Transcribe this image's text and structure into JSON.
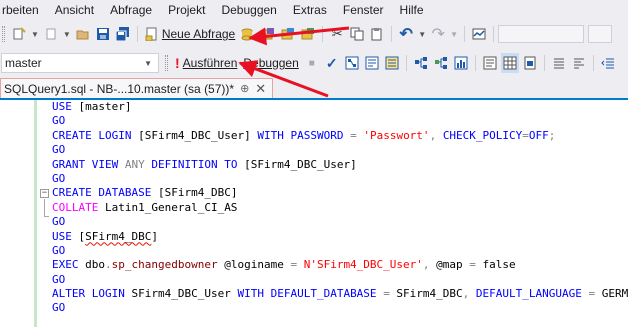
{
  "menu": {
    "items": [
      "rbeiten",
      "Ansicht",
      "Abfrage",
      "Projekt",
      "Debuggen",
      "Extras",
      "Fenster",
      "Hilfe"
    ]
  },
  "toolbar1": {
    "new_query_label": "Neue Abfrage"
  },
  "toolbar2": {
    "database_value": "master",
    "execute_label": "Ausführen",
    "debug_label": "Debuggen"
  },
  "tab": {
    "title": "SQLQuery1.sql - NB-...10.master (sa (57))*",
    "pin_glyph": "⊕",
    "close_glyph": "✕"
  },
  "code_lines": [
    [
      {
        "c": "kw",
        "t": "USE"
      },
      {
        "c": "tx",
        "t": " [master]"
      }
    ],
    [
      {
        "c": "kw",
        "t": "GO"
      }
    ],
    [
      {
        "c": "kw",
        "t": "CREATE"
      },
      {
        "c": "tx",
        "t": " "
      },
      {
        "c": "kw",
        "t": "LOGIN"
      },
      {
        "c": "tx",
        "t": " [SFirm4_DBC_User] "
      },
      {
        "c": "kw",
        "t": "WITH"
      },
      {
        "c": "tx",
        "t": " "
      },
      {
        "c": "kw",
        "t": "PASSWORD"
      },
      {
        "c": "tx",
        "t": " "
      },
      {
        "c": "gr",
        "t": "="
      },
      {
        "c": "tx",
        "t": " "
      },
      {
        "c": "st",
        "t": "'Passwort'"
      },
      {
        "c": "gr",
        "t": ","
      },
      {
        "c": "tx",
        "t": " "
      },
      {
        "c": "kw",
        "t": "CHECK_POLICY"
      },
      {
        "c": "gr",
        "t": "="
      },
      {
        "c": "kw",
        "t": "OFF"
      },
      {
        "c": "gr",
        "t": ";"
      }
    ],
    [
      {
        "c": "kw",
        "t": "GO"
      }
    ],
    [
      {
        "c": "kw",
        "t": "GRANT"
      },
      {
        "c": "tx",
        "t": " "
      },
      {
        "c": "kw",
        "t": "VIEW"
      },
      {
        "c": "tx",
        "t": " "
      },
      {
        "c": "gr",
        "t": "ANY"
      },
      {
        "c": "tx",
        "t": " "
      },
      {
        "c": "kw",
        "t": "DEFINITION"
      },
      {
        "c": "tx",
        "t": " "
      },
      {
        "c": "kw",
        "t": "TO"
      },
      {
        "c": "tx",
        "t": " [SFirm4_DBC_User]"
      }
    ],
    [
      {
        "c": "kw",
        "t": "GO"
      }
    ],
    [
      {
        "c": "kw",
        "t": "CREATE"
      },
      {
        "c": "tx",
        "t": " "
      },
      {
        "c": "kw",
        "t": "DATABASE"
      },
      {
        "c": "tx",
        "t": " [SFirm4_DBC]"
      }
    ],
    [
      {
        "c": "kwf",
        "t": "COLLATE"
      },
      {
        "c": "tx",
        "t": " Latin1_General_CI_AS"
      }
    ],
    [
      {
        "c": "kw",
        "t": "GO"
      }
    ],
    [
      {
        "c": "kw",
        "t": "USE"
      },
      {
        "c": "tx",
        "t": " ["
      },
      {
        "c": "tx squig",
        "t": "SFirm4_DBC"
      },
      {
        "c": "tx",
        "t": "]"
      }
    ],
    [
      {
        "c": "kw",
        "t": "GO"
      }
    ],
    [
      {
        "c": "kw",
        "t": "EXEC"
      },
      {
        "c": "tx",
        "t": " dbo"
      },
      {
        "c": "gr",
        "t": "."
      },
      {
        "c": "fn",
        "t": "sp_changedbowner"
      },
      {
        "c": "tx",
        "t": " @loginame "
      },
      {
        "c": "gr",
        "t": "="
      },
      {
        "c": "tx",
        "t": " "
      },
      {
        "c": "st",
        "t": "N'SFirm4_DBC_User'"
      },
      {
        "c": "gr",
        "t": ","
      },
      {
        "c": "tx",
        "t": " @map "
      },
      {
        "c": "gr",
        "t": "="
      },
      {
        "c": "tx",
        "t": " false"
      }
    ],
    [
      {
        "c": "kw",
        "t": "GO"
      }
    ],
    [
      {
        "c": "kw",
        "t": "ALTER"
      },
      {
        "c": "tx",
        "t": " "
      },
      {
        "c": "kw",
        "t": "LOGIN"
      },
      {
        "c": "tx",
        "t": " SFirm4_DBC_User "
      },
      {
        "c": "kw",
        "t": "WITH"
      },
      {
        "c": "tx",
        "t": " "
      },
      {
        "c": "kw",
        "t": "DEFAULT_DATABASE"
      },
      {
        "c": "tx",
        "t": " "
      },
      {
        "c": "gr",
        "t": "="
      },
      {
        "c": "tx",
        "t": " SFirm4_DBC"
      },
      {
        "c": "gr",
        "t": ","
      },
      {
        "c": "tx",
        "t": " "
      },
      {
        "c": "kw",
        "t": "DEFAULT_LANGUAGE"
      },
      {
        "c": "tx",
        "t": " "
      },
      {
        "c": "gr",
        "t": "="
      },
      {
        "c": "tx",
        "t": " GERMAN"
      }
    ],
    [
      {
        "c": "kw",
        "t": "GO"
      }
    ]
  ],
  "colors": {
    "arrow": "#e81123",
    "accent": "#007acc",
    "keyword": "#0000ff",
    "string": "#ff0000",
    "function": "#800000"
  }
}
